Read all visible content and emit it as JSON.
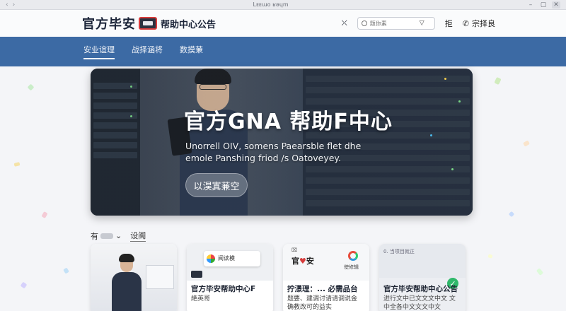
{
  "browser": {
    "url": "Lᴇᴇɯo ʁǝɥm",
    "back": "‹",
    "forward": "›",
    "controls": [
      "–",
      "▢",
      "✕"
    ]
  },
  "header": {
    "brand_name": "官方毕安",
    "brand_sub": "帮助中心公告",
    "icon_label": "⛌",
    "search_placeholder": "题你素",
    "link_label": "拒",
    "contact_label": "宗择良"
  },
  "nav": {
    "items": [
      {
        "label": "安业谊理",
        "active": true
      },
      {
        "label": "战择涵将",
        "active": false
      },
      {
        "label": "数摸蒹",
        "active": false
      }
    ]
  },
  "hero": {
    "title": "官方GNA 帮助F中心",
    "description": "Unorrell OIV, somens Paearsble flet dhe emole Panshing friod /s Oatoveyey.",
    "button_label": "以淏寘蒹空"
  },
  "filter": {
    "select_label": "有",
    "link_label": "设阁"
  },
  "cards": [
    {
      "title": "",
      "subtitle": ""
    },
    {
      "title": "官方毕安帮助中心F",
      "subtitle": "絶英哥",
      "panel_text": "阅读模"
    },
    {
      "title": "拧澋理：... 必需品台",
      "subtitle": "题要、建调讨请请调说金 确教改可的益实",
      "logo_a": "官",
      "logo_a2": "安",
      "logo_b": "使修辑",
      "mini": "⌧"
    },
    {
      "title": "官方毕安帮助中心公告",
      "subtitle": "进行文中已文文文中文 文中全各中文文文中文",
      "mini": "0. 当项目就正"
    }
  ],
  "colors": {
    "nav_bg": "#3c6aa4",
    "brand_red": "#d63b3b",
    "check_green": "#2fb86a"
  }
}
